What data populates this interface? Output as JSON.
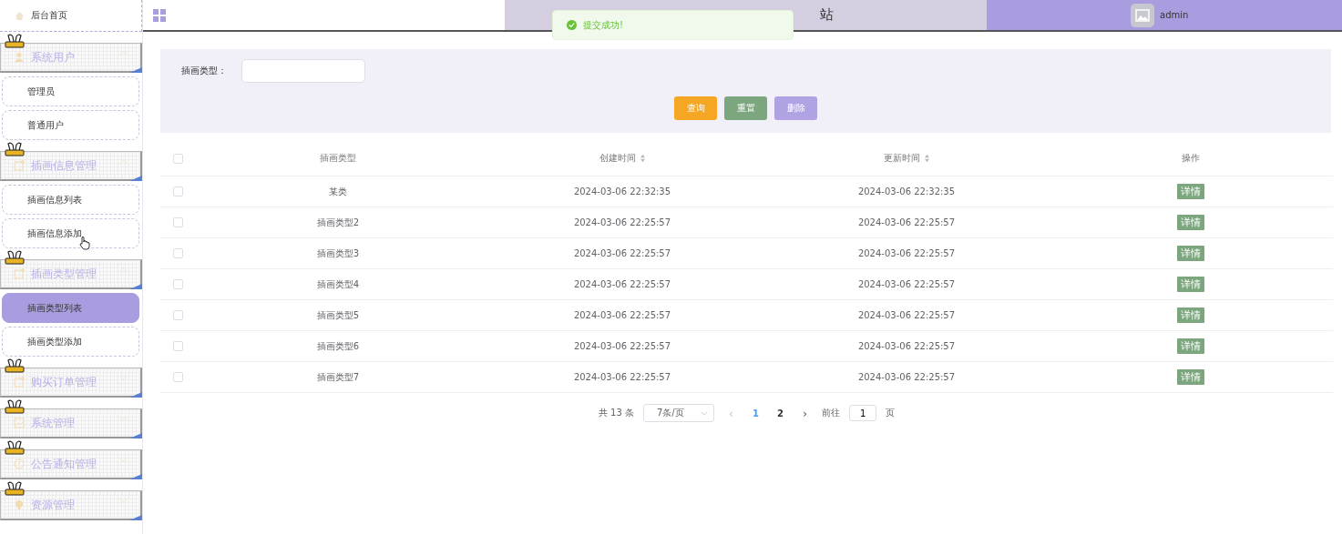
{
  "sidebar": {
    "home": {
      "label": "后台首页"
    },
    "groups": [
      {
        "label": "系统用户",
        "kind": "user",
        "expanded": true,
        "children": [
          {
            "label": "管理员",
            "selected": false
          },
          {
            "label": "普通用户",
            "selected": false
          }
        ]
      },
      {
        "label": "插画信息管理",
        "kind": "note",
        "expanded": true,
        "children": [
          {
            "label": "插画信息列表",
            "selected": false
          },
          {
            "label": "插画信息添加",
            "selected": false
          }
        ]
      },
      {
        "label": "插画类型管理",
        "kind": "note",
        "expanded": true,
        "children": [
          {
            "label": "插画类型列表",
            "selected": true
          },
          {
            "label": "插画类型添加",
            "selected": false
          }
        ]
      },
      {
        "label": "购买订单管理",
        "kind": "note",
        "expanded": false
      },
      {
        "label": "系统管理",
        "kind": "image",
        "expanded": false
      },
      {
        "label": "公告通知管理",
        "kind": "info",
        "expanded": false
      },
      {
        "label": "资源管理",
        "kind": "bulb",
        "expanded": false
      }
    ]
  },
  "header": {
    "title": "站",
    "user": "admin"
  },
  "toast": {
    "message": "提交成功!"
  },
  "search": {
    "label": "插画类型：",
    "buttons": [
      {
        "label": "查询",
        "kind": "query"
      },
      {
        "label": "重置",
        "kind": "reset"
      },
      {
        "label": "删除",
        "kind": "delete"
      }
    ]
  },
  "table": {
    "all_checked": false,
    "columns": [
      {
        "label": "插画类型",
        "sortable": false
      },
      {
        "label": "创建时间",
        "sortable": true
      },
      {
        "label": "更新时间",
        "sortable": true
      },
      {
        "label": "操作",
        "sortable": false
      }
    ],
    "rows": [
      {
        "checked": false,
        "type": "某类",
        "created": "2024-03-06 22:32:35",
        "updated": "2024-03-06 22:32:35",
        "action": "详情"
      },
      {
        "checked": false,
        "type": "插画类型2",
        "created": "2024-03-06 22:25:57",
        "updated": "2024-03-06 22:25:57",
        "action": "详情"
      },
      {
        "checked": false,
        "type": "插画类型3",
        "created": "2024-03-06 22:25:57",
        "updated": "2024-03-06 22:25:57",
        "action": "详情"
      },
      {
        "checked": false,
        "type": "插画类型4",
        "created": "2024-03-06 22:25:57",
        "updated": "2024-03-06 22:25:57",
        "action": "详情"
      },
      {
        "checked": false,
        "type": "插画类型5",
        "created": "2024-03-06 22:25:57",
        "updated": "2024-03-06 22:25:57",
        "action": "详情"
      },
      {
        "checked": false,
        "type": "插画类型6",
        "created": "2024-03-06 22:25:57",
        "updated": "2024-03-06 22:25:57",
        "action": "详情"
      },
      {
        "checked": false,
        "type": "插画类型7",
        "created": "2024-03-06 22:25:57",
        "updated": "2024-03-06 22:25:57",
        "action": "详情"
      }
    ]
  },
  "pagination": {
    "total": "共 13 条",
    "page_size": "7条/页",
    "prev": "‹",
    "pages": [
      {
        "label": "1",
        "selected": true
      },
      {
        "label": "2",
        "selected": false
      }
    ],
    "next": "›",
    "goto_label": "前往",
    "goto_value": "1",
    "goto_suffix": "页"
  }
}
